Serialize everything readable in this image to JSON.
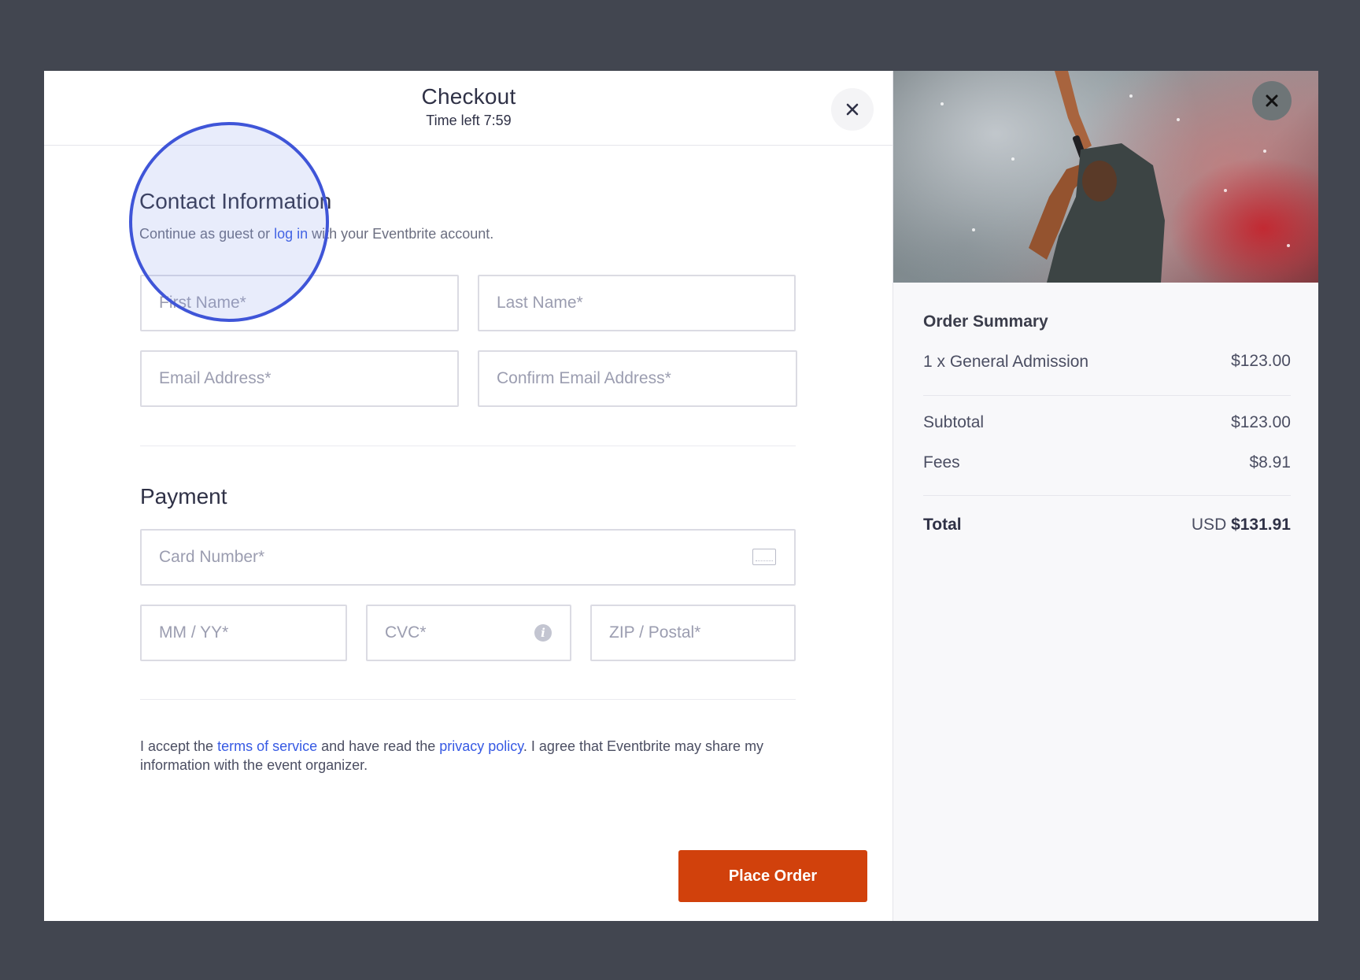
{
  "checkout": {
    "title": "Checkout",
    "timer": "Time left 7:59"
  },
  "contact": {
    "title": "Contact Information",
    "subtext_before": "Continue as guest or ",
    "login_link": "log in",
    "subtext_after": " with your Eventbrite account.",
    "first_name_placeholder": "First Name*",
    "last_name_placeholder": "Last Name*",
    "email_placeholder": "Email Address*",
    "confirm_email_placeholder": "Confirm Email Address*"
  },
  "payment": {
    "title": "Payment",
    "card_number_placeholder": "Card Number*",
    "expiry_placeholder": "MM / YY*",
    "cvc_placeholder": "CVC*",
    "zip_placeholder": "ZIP / Postal*",
    "card_icon": "credit-card-icon",
    "info_icon": "info-icon"
  },
  "terms": {
    "part1": "I accept the ",
    "tos_link": "terms of service",
    "part2": " and have read the ",
    "privacy_link": "privacy policy",
    "part3": ". I agree that Eventbrite may share my information with the event organizer."
  },
  "actions": {
    "place_order": "Place Order"
  },
  "order_summary": {
    "title": "Order Summary",
    "item_label": "1 x General Admission",
    "item_price": "$123.00",
    "subtotal_label": "Subtotal",
    "subtotal_value": "$123.00",
    "fees_label": "Fees",
    "fees_value": "$8.91",
    "total_label": "Total",
    "total_currency": "USD",
    "total_value": "$131.91"
  },
  "colors": {
    "accent": "#d1410c",
    "link": "#3659e3",
    "highlight": "#3f55d8",
    "backdrop": "#424650"
  }
}
